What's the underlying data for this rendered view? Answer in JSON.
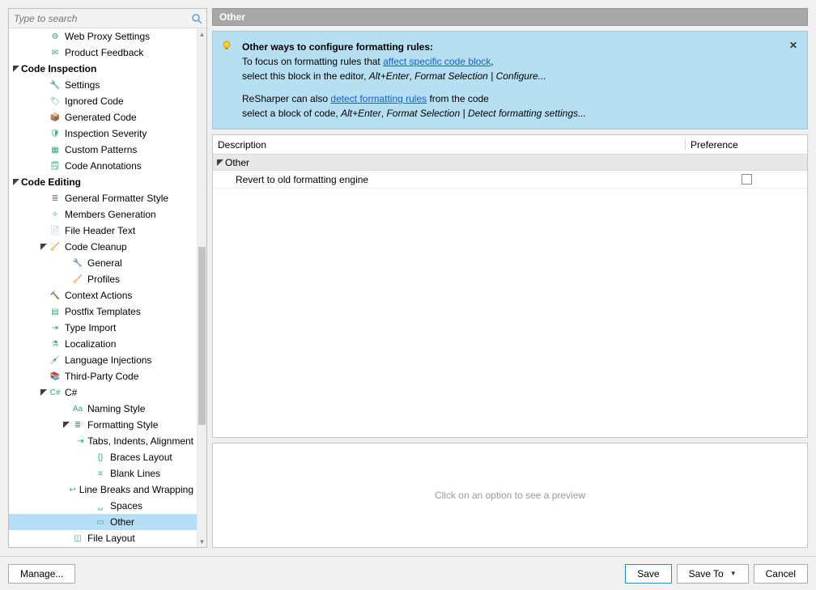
{
  "search": {
    "placeholder": "Type to search"
  },
  "tree": {
    "items": [
      {
        "level": 1,
        "label": "Web Proxy Settings",
        "icon": "gear-blue",
        "twisty": ""
      },
      {
        "level": 1,
        "label": "Product Feedback",
        "icon": "mail",
        "twisty": ""
      },
      {
        "level": 0,
        "label": "Code Inspection",
        "icon": "",
        "twisty": "down",
        "bold": true
      },
      {
        "level": 1,
        "label": "Settings",
        "icon": "wrench",
        "twisty": ""
      },
      {
        "level": 1,
        "label": "Ignored Code",
        "icon": "tag-red",
        "twisty": ""
      },
      {
        "level": 1,
        "label": "Generated Code",
        "icon": "box-green",
        "twisty": ""
      },
      {
        "level": 1,
        "label": "Inspection Severity",
        "icon": "shield",
        "twisty": ""
      },
      {
        "level": 1,
        "label": "Custom Patterns",
        "icon": "grid",
        "twisty": ""
      },
      {
        "level": 1,
        "label": "Code Annotations",
        "icon": "note",
        "twisty": ""
      },
      {
        "level": 0,
        "label": "Code Editing",
        "icon": "",
        "twisty": "down",
        "bold": true
      },
      {
        "level": 1,
        "label": "General Formatter Style",
        "icon": "format",
        "twisty": ""
      },
      {
        "level": 1,
        "label": "Members Generation",
        "icon": "gen",
        "twisty": ""
      },
      {
        "level": 1,
        "label": "File Header Text",
        "icon": "file",
        "twisty": ""
      },
      {
        "level": 1,
        "label": "Code Cleanup",
        "icon": "broom",
        "twisty": "down"
      },
      {
        "level": 2,
        "label": "General",
        "icon": "wrench2",
        "twisty": ""
      },
      {
        "level": 2,
        "label": "Profiles",
        "icon": "broom",
        "twisty": ""
      },
      {
        "level": 1,
        "label": "Context Actions",
        "icon": "hammer",
        "twisty": ""
      },
      {
        "level": 1,
        "label": "Postfix Templates",
        "icon": "page",
        "twisty": ""
      },
      {
        "level": 1,
        "label": "Type Import",
        "icon": "import",
        "twisty": ""
      },
      {
        "level": 1,
        "label": "Localization",
        "icon": "flask",
        "twisty": ""
      },
      {
        "level": 1,
        "label": "Language Injections",
        "icon": "syringe",
        "twisty": ""
      },
      {
        "level": 1,
        "label": "Third-Party Code",
        "icon": "lib",
        "twisty": ""
      },
      {
        "level": 1,
        "label": "C#",
        "icon": "csharp",
        "twisty": "down"
      },
      {
        "level": 2,
        "label": "Naming Style",
        "icon": "aa",
        "twisty": ""
      },
      {
        "level": 2,
        "label": "Formatting Style",
        "icon": "format",
        "twisty": "down"
      },
      {
        "level": 3,
        "label": "Tabs, Indents, Alignment",
        "icon": "indent",
        "twisty": ""
      },
      {
        "level": 3,
        "label": "Braces Layout",
        "icon": "braces",
        "twisty": ""
      },
      {
        "level": 3,
        "label": "Blank Lines",
        "icon": "blank",
        "twisty": ""
      },
      {
        "level": 3,
        "label": "Line Breaks and Wrapping",
        "icon": "wrap",
        "twisty": ""
      },
      {
        "level": 3,
        "label": "Spaces",
        "icon": "spaces",
        "twisty": ""
      },
      {
        "level": 3,
        "label": "Other",
        "icon": "other",
        "twisty": "",
        "selected": true
      },
      {
        "level": 2,
        "label": "File Layout",
        "icon": "layout",
        "twisty": ""
      }
    ]
  },
  "panel": {
    "title": "Other",
    "info": {
      "heading": "Other ways to configure formatting rules:",
      "line1a": "To focus on formatting rules that ",
      "link1": "affect specific code block",
      "line1b": ",",
      "line2a": "select this block in the editor, ",
      "line2b_ital": "Alt+Enter",
      "line2c": ", ",
      "line2d_ital": "Format Selection | Configure...",
      "line3a": "ReSharper can also ",
      "link2": "detect formatting rules",
      "line3b": " from the code",
      "line4a": "select a block of code, ",
      "line4b_ital": "Alt+Enter",
      "line4c": ", ",
      "line4d_ital": "Format Selection | Detect formatting settings..."
    },
    "table": {
      "col1": "Description",
      "col2": "Preference",
      "group": "Other",
      "row1": "Revert to old formatting engine"
    },
    "preview_text": "Click on an option to see a preview"
  },
  "footer": {
    "manage": "Manage...",
    "save": "Save",
    "saveto": "Save To",
    "cancel": "Cancel"
  },
  "icons": {
    "gear-blue": "⚙",
    "mail": "✉",
    "wrench": "🔧",
    "tag-red": "🏷",
    "box-green": "📦",
    "shield": "🛡",
    "grid": "▦",
    "note": "🗒",
    "format": "≣",
    "gen": "✧",
    "file": "📄",
    "broom": "🧹",
    "wrench2": "🔧",
    "hammer": "🔨",
    "page": "▤",
    "import": "⇥",
    "flask": "⚗",
    "syringe": "💉",
    "lib": "📚",
    "csharp": "C#",
    "aa": "Aa",
    "indent": "⇥",
    "braces": "{}",
    "blank": "≡",
    "wrap": "↩",
    "spaces": "␣",
    "other": "▭",
    "layout": "◫"
  }
}
